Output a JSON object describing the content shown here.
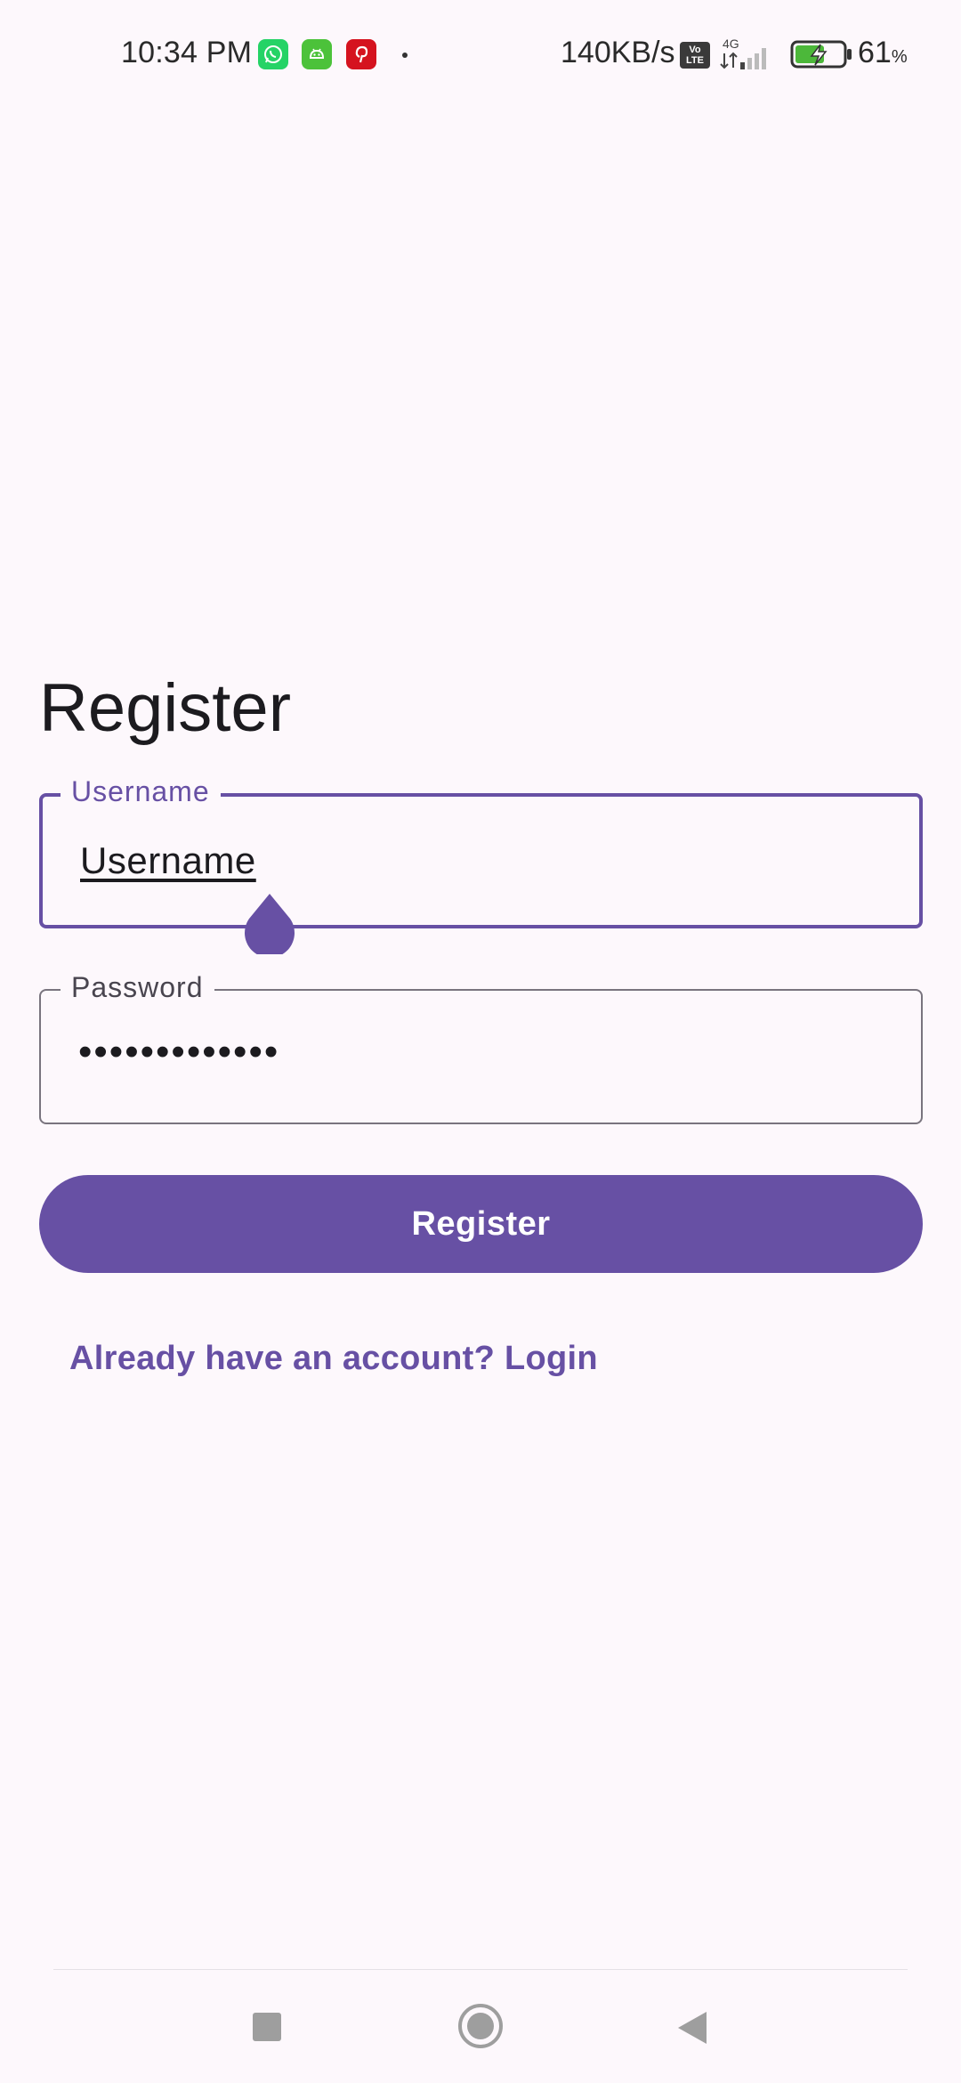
{
  "status_bar": {
    "time": "10:34 PM",
    "notification_icons": [
      "whatsapp-icon",
      "android-icon",
      "pinterest-icon"
    ],
    "network_speed": "140KB/s",
    "volte_label_top": "Vo",
    "volte_label_bottom": "LTE",
    "network_type": "4G",
    "battery_percent": "61",
    "battery_unit": "%"
  },
  "form": {
    "title": "Register",
    "username": {
      "label": "Username",
      "value": "Username"
    },
    "password": {
      "label": "Password",
      "value": "•••••••••••••"
    },
    "submit_label": "Register",
    "login_link": "Already have an account? Login"
  },
  "colors": {
    "primary": "#6750a4",
    "background": "#fdf8fc",
    "outline": "#79747e",
    "on_surface": "#1c1b1f"
  },
  "nav_bar": {
    "icons": [
      "recents-icon",
      "home-icon",
      "back-icon"
    ]
  }
}
